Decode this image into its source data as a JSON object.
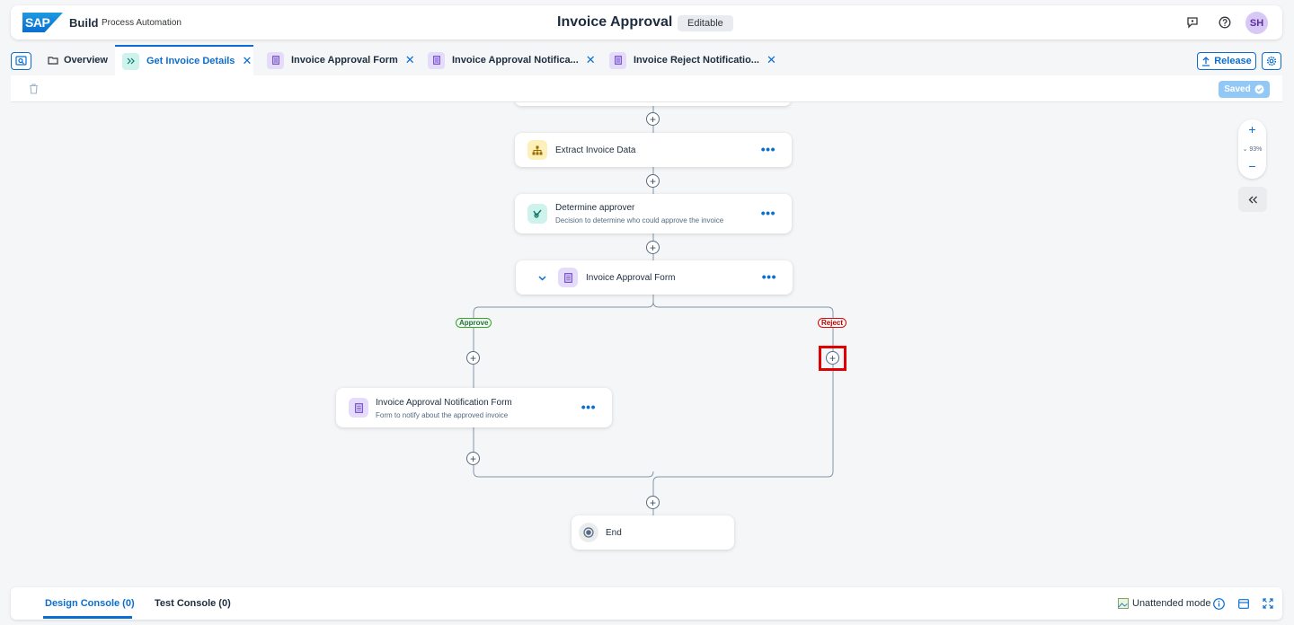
{
  "shell": {
    "logo_text": "SAP",
    "brand": "Build",
    "brand_sub": "Process Automation",
    "title": "Invoice Approval",
    "status": "Editable",
    "avatar_initials": "SH"
  },
  "tabs": [
    {
      "label": "Overview",
      "icon": "folder-icon"
    },
    {
      "label": "Get Invoice Details",
      "icon": "process-icon",
      "active": true
    },
    {
      "label": "Invoice Approval Form",
      "icon": "form-icon"
    },
    {
      "label": "Invoice Approval Notifica...",
      "icon": "form-icon"
    },
    {
      "label": "Invoice Reject Notificatio...",
      "icon": "form-icon"
    }
  ],
  "tab_close": "✕",
  "toolbar": {
    "release_label": "Release",
    "saved_label": "Saved"
  },
  "canvas": {
    "zoom_level": "93%",
    "nodes": {
      "extract": {
        "title": "Extract Invoice Data"
      },
      "determine": {
        "title": "Determine approver",
        "desc": "Decision to determine who could approve the invoice"
      },
      "approval_form": {
        "title": "Invoice Approval Form"
      },
      "notification": {
        "title": "Invoice Approval Notification Form",
        "desc": "Form to notify about the approved invoice"
      },
      "end": {
        "title": "End"
      }
    },
    "branches": {
      "approve": "Approve",
      "reject": "Reject"
    },
    "more_label": "•••",
    "plus_label": "+"
  },
  "console": {
    "design_tab": "Design Console (0)",
    "test_tab": "Test Console (0)",
    "mode_label": "Unattended mode"
  },
  "colors": {
    "accent": "#0a6ed1",
    "approve": "#36a41d",
    "reject": "#d20a0a"
  }
}
